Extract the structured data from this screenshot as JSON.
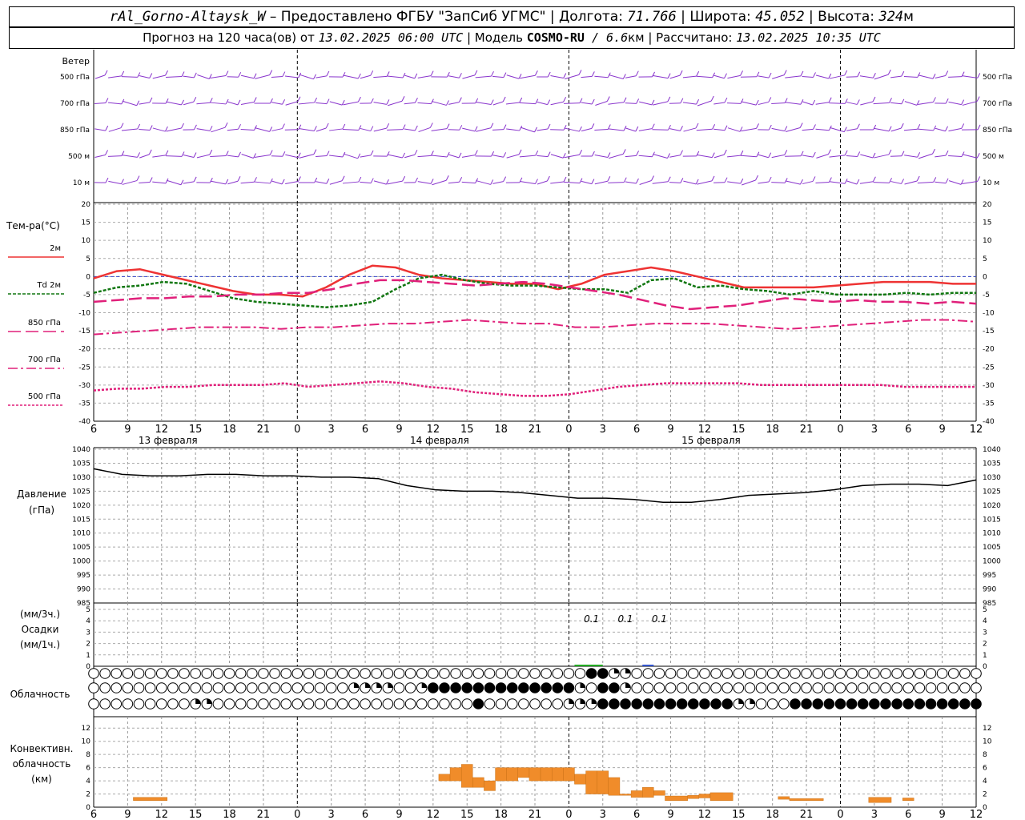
{
  "header": {
    "station": "rAl_Gorno-Altaysk_W",
    "dash": " – ",
    "provider": "Предоставлено ФГБУ \"ЗапСиб УГМС\"",
    "sep": " | ",
    "lon_label": "Долгота: ",
    "lon_value": "71.766",
    "lat_label": "Широта: ",
    "lat_value": "45.052",
    "alt_label": "Высота: ",
    "alt_value": "324",
    "alt_unit": "м",
    "forecast_prefix": "Прогноз на 120 часа(ов) от ",
    "forecast_time": "13.02.2025 06:00 UTC",
    "model_label": " | Модель ",
    "model_name": "COSMO-RU",
    "model_res": " / 6.6",
    "model_unit": "км",
    "calc_label": " | Рассчитано: ",
    "calc_time": "13.02.2025 10:35 UTC"
  },
  "labels": {
    "wind": "Ветер",
    "wind_levels": [
      "500 гПа",
      "700 гПа",
      "850 гПа",
      "500 м",
      "10 м"
    ],
    "temp": "Тем-ра(°C)",
    "legend": [
      {
        "text": "2м",
        "color": "#ee3333",
        "dash": ""
      },
      {
        "text": "Td 2м",
        "color": "#117711",
        "dash": "4,2"
      },
      {
        "text": "850 гПа",
        "color": "#e0207a",
        "dash": "16,6"
      },
      {
        "text": "700 гПа",
        "color": "#e0207a",
        "dash": "12,4,3,4"
      },
      {
        "text": "500 гПа",
        "color": "#e0207a",
        "dash": "3,2"
      }
    ],
    "pressure": [
      "Давление",
      "(гПа)"
    ],
    "precip": [
      "(мм/3ч.)",
      "Осадки",
      "(мм/1ч.)"
    ],
    "cloud": "Облачность",
    "conv": [
      "Конвективн.",
      "облачность",
      "(км)"
    ],
    "dates": [
      "13 февраля",
      "14 февраля",
      "15 февраля"
    ],
    "hours": [
      "6",
      "9",
      "12",
      "15",
      "18",
      "21",
      "0",
      "3",
      "6",
      "9",
      "12",
      "15",
      "18",
      "21",
      "0",
      "3",
      "6",
      "9",
      "12",
      "15",
      "18",
      "21",
      "0",
      "3",
      "6",
      "9",
      "12"
    ]
  },
  "chart_data": {
    "type": "line",
    "x_hours_from_start": [
      0,
      3,
      6,
      9,
      12,
      15,
      18,
      21,
      24,
      27,
      30,
      33,
      36,
      39,
      42,
      45,
      48,
      51,
      54,
      57,
      60,
      63,
      66,
      69,
      72,
      75,
      78
    ],
    "temperature": {
      "yticks": [
        20,
        15,
        10,
        5,
        0,
        -5,
        -10,
        -15,
        -20,
        -25,
        -30,
        -35,
        -40
      ],
      "ylim": [
        -40,
        20
      ],
      "series": [
        {
          "name": "2м",
          "values": [
            -0.5,
            1.5,
            2,
            0.5,
            -1,
            -2.5,
            -4,
            -5,
            -5,
            -5.5,
            -3,
            0.5,
            3,
            2.5,
            0.5,
            -0.5,
            -1,
            -1.5,
            -2,
            -2,
            -3.5,
            -2,
            0.5,
            1.5,
            2.5,
            1.5,
            0,
            -1.5,
            -3,
            -3,
            -3,
            -3,
            -2.5,
            -2,
            -1.5,
            -1.5,
            -1.5,
            -2,
            -2
          ]
        },
        {
          "name": "Td 2м",
          "values": [
            -4.5,
            -3,
            -2.5,
            -1.5,
            -2,
            -4,
            -6,
            -7,
            -7.5,
            -8,
            -8.5,
            -8,
            -7,
            -3.5,
            -0.5,
            0.5,
            -1,
            -2,
            -2.5,
            -2.5,
            -3,
            -3.5,
            -3.5,
            -4.5,
            -1,
            -0.5,
            -3,
            -2.5,
            -3.5,
            -4,
            -5,
            -4,
            -5,
            -5,
            -5,
            -4.5,
            -5,
            -4.5,
            -4.5
          ]
        },
        {
          "name": "850 гПа",
          "values": [
            -7,
            -6.5,
            -6,
            -6,
            -5.5,
            -5.5,
            -5,
            -5,
            -4.5,
            -4.5,
            -3.5,
            -2,
            -1,
            -1,
            -1.5,
            -2,
            -2.5,
            -2,
            -1.5,
            -2,
            -3,
            -4,
            -5,
            -6.5,
            -8,
            -9,
            -8.5,
            -8,
            -7,
            -6,
            -6.5,
            -7,
            -6.5,
            -7,
            -7,
            -7.5,
            -7,
            -7.5
          ]
        },
        {
          "name": "700 гПа",
          "values": [
            -16,
            -15.5,
            -15,
            -14.5,
            -14,
            -14,
            -14,
            -14.5,
            -14,
            -14,
            -13.5,
            -13,
            -13,
            -12.5,
            -12,
            -12.5,
            -13,
            -13,
            -14,
            -14,
            -13.5,
            -13,
            -13,
            -13,
            -13.5,
            -14,
            -14.5,
            -14,
            -13.5,
            -13,
            -12.5,
            -12,
            -12,
            -12.5
          ]
        },
        {
          "name": "500 гПа",
          "values": [
            -31.5,
            -31,
            -31,
            -30.5,
            -30.5,
            -30,
            -30,
            -30,
            -29.5,
            -30.5,
            -30,
            -29.5,
            -29,
            -29.5,
            -30.5,
            -31,
            -32,
            -32.5,
            -33,
            -33,
            -32.5,
            -31.5,
            -30.5,
            -30,
            -29.5,
            -29.5,
            -29.5,
            -29.5,
            -30,
            -30,
            -30,
            -30,
            -30,
            -30,
            -30.5,
            -30.5,
            -30.5,
            -30.5
          ]
        }
      ]
    },
    "pressure": {
      "yticks": [
        1040,
        1035,
        1030,
        1025,
        1020,
        1015,
        1010,
        1005,
        1000,
        995,
        990,
        985
      ],
      "ylim": [
        985,
        1040
      ],
      "series": [
        {
          "name": "",
          "values": [
            1033,
            1031,
            1030.5,
            1030.5,
            1031,
            1031,
            1030.5,
            1030.5,
            1030,
            1030,
            1029.5,
            1027,
            1025.5,
            1025,
            1025,
            1024.5,
            1023.5,
            1022.5,
            1022.5,
            1022,
            1021,
            1021,
            1022,
            1023.5,
            1024,
            1024.5,
            1025.5,
            1027,
            1027.5,
            1027.5,
            1027,
            1029
          ]
        }
      ]
    },
    "precip": {
      "yticks": [
        5,
        4,
        3,
        2,
        1,
        0
      ],
      "ylim": [
        0,
        5
      ],
      "annotations": [
        "0.1",
        "0.1",
        "0.1"
      ]
    },
    "convective": {
      "yticks": [
        12,
        10,
        8,
        6,
        4,
        2,
        0
      ],
      "ylim": [
        0,
        13
      ],
      "bars": [
        {
          "x": 3.5,
          "w": 3,
          "bottom": 1,
          "top": 1.5
        },
        {
          "x": 30.5,
          "w": 1,
          "bottom": 4,
          "top": 5
        },
        {
          "x": 31.5,
          "w": 1,
          "bottom": 4,
          "top": 6
        },
        {
          "x": 32.5,
          "w": 1,
          "bottom": 3,
          "top": 6.5
        },
        {
          "x": 33.5,
          "w": 1,
          "bottom": 3,
          "top": 4.5
        },
        {
          "x": 34.5,
          "w": 1,
          "bottom": 2.5,
          "top": 4
        },
        {
          "x": 35.5,
          "w": 1,
          "bottom": 4,
          "top": 6
        },
        {
          "x": 36.5,
          "w": 1,
          "bottom": 4,
          "top": 6
        },
        {
          "x": 37.5,
          "w": 1,
          "bottom": 4.5,
          "top": 6
        },
        {
          "x": 38.5,
          "w": 1,
          "bottom": 4,
          "top": 6
        },
        {
          "x": 39.5,
          "w": 1,
          "bottom": 4,
          "top": 6
        },
        {
          "x": 40.5,
          "w": 1,
          "bottom": 4,
          "top": 6
        },
        {
          "x": 41.5,
          "w": 1,
          "bottom": 4,
          "top": 6
        },
        {
          "x": 42.5,
          "w": 1,
          "bottom": 3.5,
          "top": 5
        },
        {
          "x": 43.5,
          "w": 1,
          "bottom": 2,
          "top": 5.5
        },
        {
          "x": 44.5,
          "w": 1,
          "bottom": 2,
          "top": 5.5
        },
        {
          "x": 45.5,
          "w": 1,
          "bottom": 1.8,
          "top": 4.5
        },
        {
          "x": 46.5,
          "w": 1,
          "bottom": 1.8,
          "top": 2
        },
        {
          "x": 47.5,
          "w": 1,
          "bottom": 1.5,
          "top": 2.5
        },
        {
          "x": 48.5,
          "w": 1,
          "bottom": 1.5,
          "top": 3
        },
        {
          "x": 49.5,
          "w": 1,
          "bottom": 1.8,
          "top": 2.5
        },
        {
          "x": 50.5,
          "w": 2,
          "bottom": 1,
          "top": 1.7
        },
        {
          "x": 52.5,
          "w": 1,
          "bottom": 1.3,
          "top": 1.8
        },
        {
          "x": 53.5,
          "w": 1,
          "bottom": 1.4,
          "top": 2
        },
        {
          "x": 54.5,
          "w": 2,
          "bottom": 1,
          "top": 2.2
        },
        {
          "x": 60.5,
          "w": 1,
          "bottom": 1.2,
          "top": 1.6
        },
        {
          "x": 61.5,
          "w": 3,
          "bottom": 1,
          "top": 1.3
        },
        {
          "x": 68.5,
          "w": 2,
          "bottom": 0.7,
          "top": 1.5
        },
        {
          "x": 71.5,
          "w": 1,
          "bottom": 1,
          "top": 1.4
        }
      ]
    }
  }
}
